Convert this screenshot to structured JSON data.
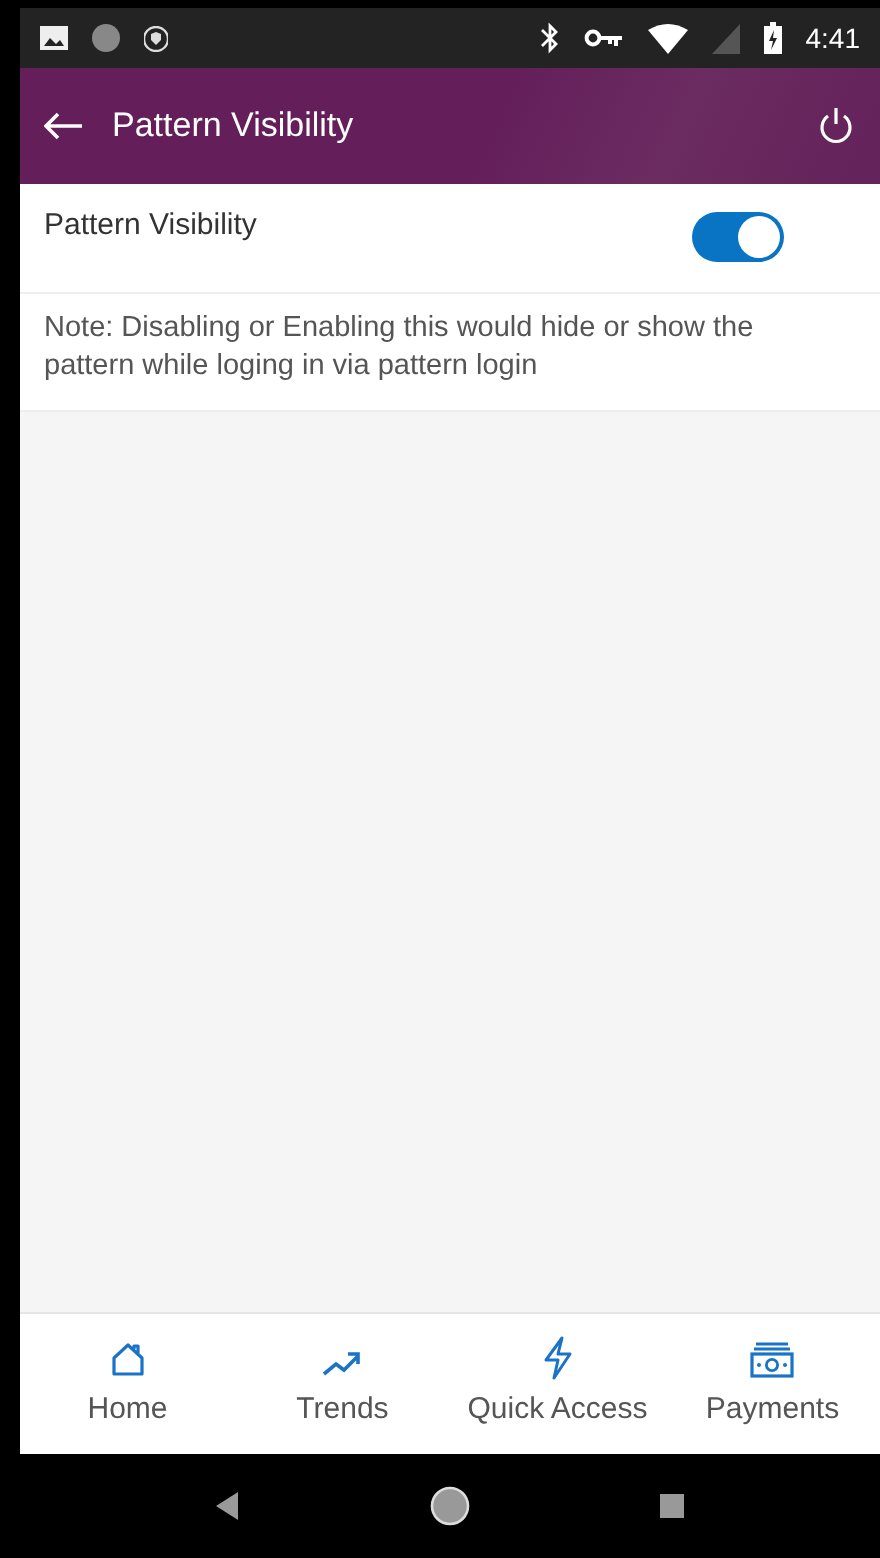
{
  "status_bar": {
    "time": "4:41"
  },
  "app_bar": {
    "title": "Pattern Visibility"
  },
  "setting": {
    "label": "Pattern Visibility",
    "on": true
  },
  "note": "Note: Disabling or Enabling this would hide or show the pattern while loging in via pattern login",
  "bottom_nav": [
    {
      "label": "Home",
      "kind": "home"
    },
    {
      "label": "Trends",
      "kind": "trends"
    },
    {
      "label": "Quick Access",
      "kind": "bolt"
    },
    {
      "label": "Payments",
      "kind": "cash"
    }
  ]
}
